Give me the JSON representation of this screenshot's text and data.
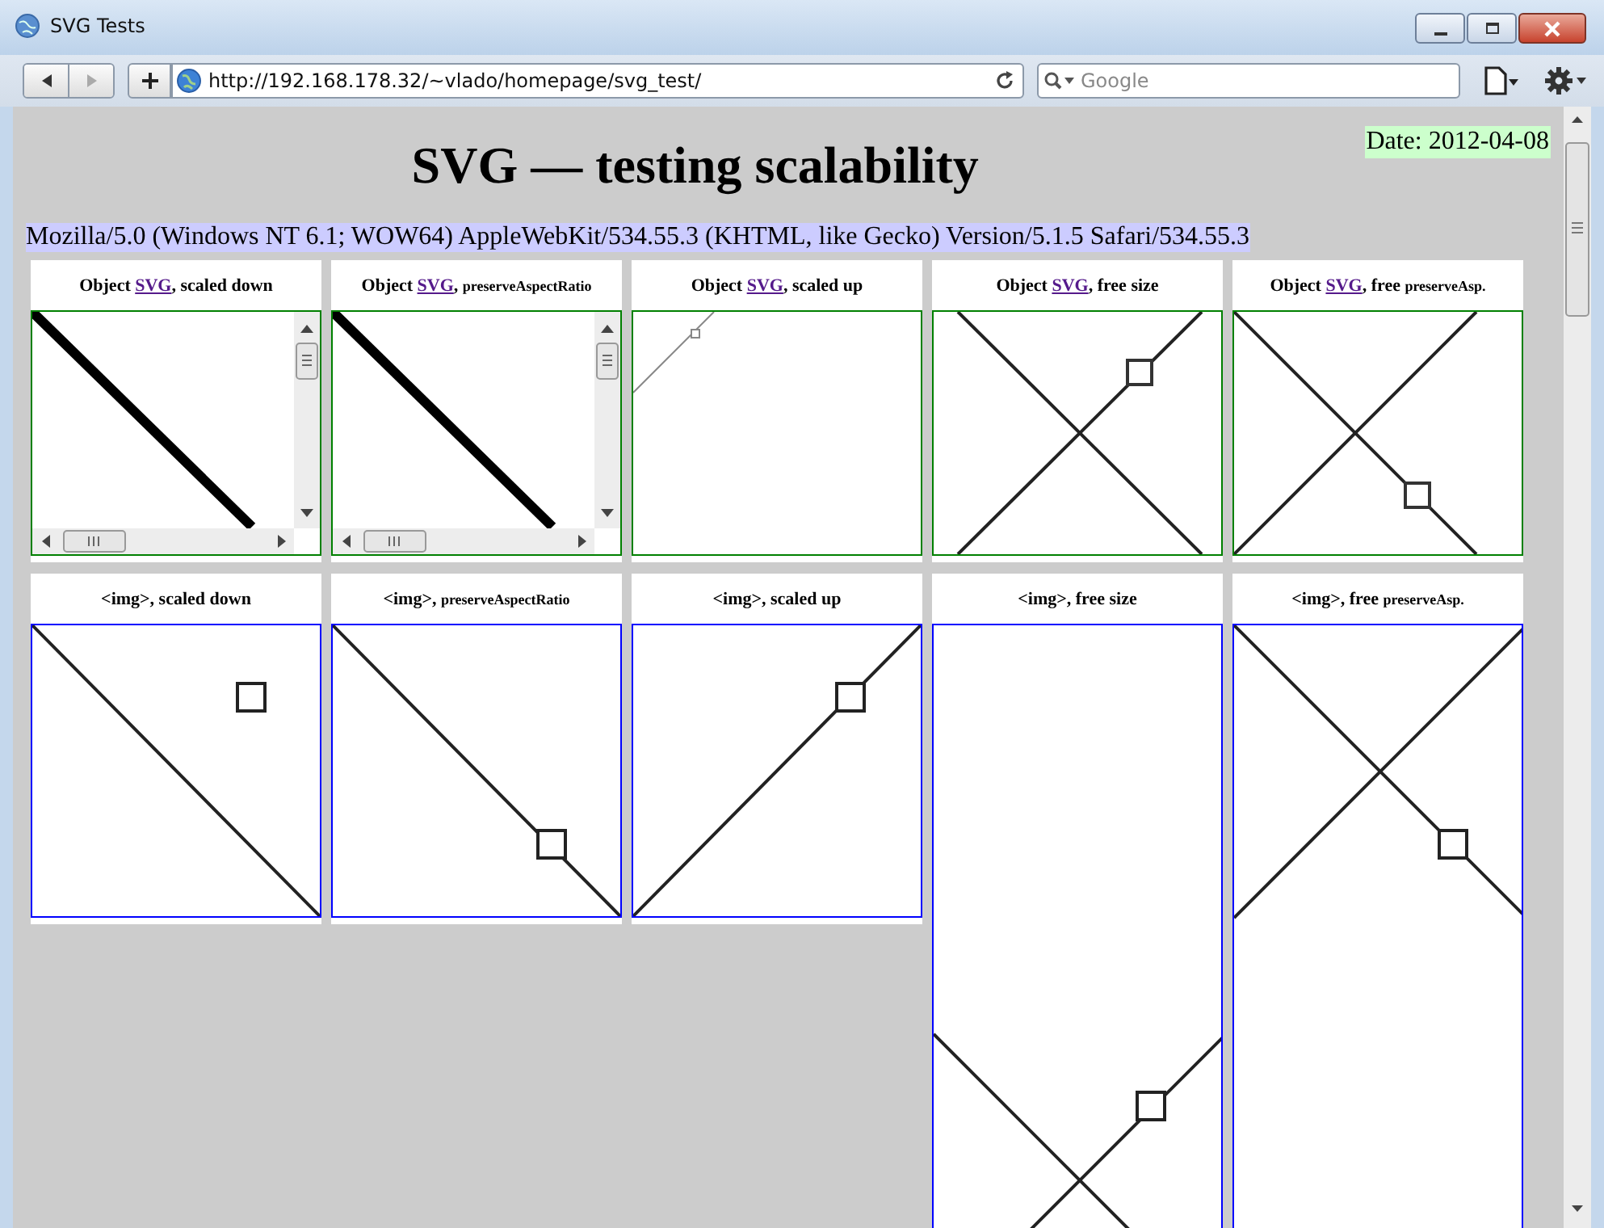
{
  "window": {
    "title": "SVG Tests"
  },
  "toolbar": {
    "url": "http://192.168.178.32/~vlado/homepage/svg_test/",
    "search": {
      "placeholder": "Google"
    }
  },
  "page": {
    "heading": "SVG — testing scalability",
    "date": "Date: 2012-04-08",
    "user_agent": "Mozilla/5.0 (Windows NT 6.1; WOW64) AppleWebKit/534.55.3 (KHTML, like Gecko) Version/5.1.5 Safari/534.55.3",
    "rows": [
      {
        "cards": [
          {
            "kind": "object",
            "caption": [
              {
                "kind": "text",
                "text": "Object "
              },
              {
                "kind": "link",
                "text": "SVG"
              },
              {
                "kind": "text",
                "text": ", scaled down"
              }
            ]
          },
          {
            "kind": "object",
            "caption": [
              {
                "kind": "text",
                "text": "Object "
              },
              {
                "kind": "link",
                "text": "SVG"
              },
              {
                "kind": "text",
                "text": ", "
              },
              {
                "kind": "small",
                "text": "preserveAspectRatio"
              }
            ]
          },
          {
            "kind": "object",
            "caption": [
              {
                "kind": "text",
                "text": "Object "
              },
              {
                "kind": "link",
                "text": "SVG"
              },
              {
                "kind": "text",
                "text": ", scaled up"
              }
            ]
          },
          {
            "kind": "object",
            "caption": [
              {
                "kind": "text",
                "text": "Object "
              },
              {
                "kind": "link",
                "text": "SVG"
              },
              {
                "kind": "text",
                "text": ", free size"
              }
            ]
          },
          {
            "kind": "object",
            "caption": [
              {
                "kind": "text",
                "text": "Object "
              },
              {
                "kind": "link",
                "text": "SVG"
              },
              {
                "kind": "text",
                "text": ", free "
              },
              {
                "kind": "small",
                "text": "preserveAsp."
              }
            ]
          }
        ]
      },
      {
        "cards": [
          {
            "kind": "img",
            "caption": [
              {
                "kind": "text",
                "text": "<img>, scaled down"
              }
            ]
          },
          {
            "kind": "img",
            "caption": [
              {
                "kind": "text",
                "text": "<img>, "
              },
              {
                "kind": "small",
                "text": "preserveAspectRatio"
              }
            ]
          },
          {
            "kind": "img",
            "caption": [
              {
                "kind": "text",
                "text": "<img>, scaled up"
              }
            ]
          },
          {
            "kind": "img",
            "caption": [
              {
                "kind": "text",
                "text": "<img>, free size"
              }
            ]
          },
          {
            "kind": "img",
            "caption": [
              {
                "kind": "text",
                "text": "<img>, free "
              },
              {
                "kind": "small",
                "text": "preserveAsp."
              }
            ]
          }
        ]
      }
    ]
  }
}
